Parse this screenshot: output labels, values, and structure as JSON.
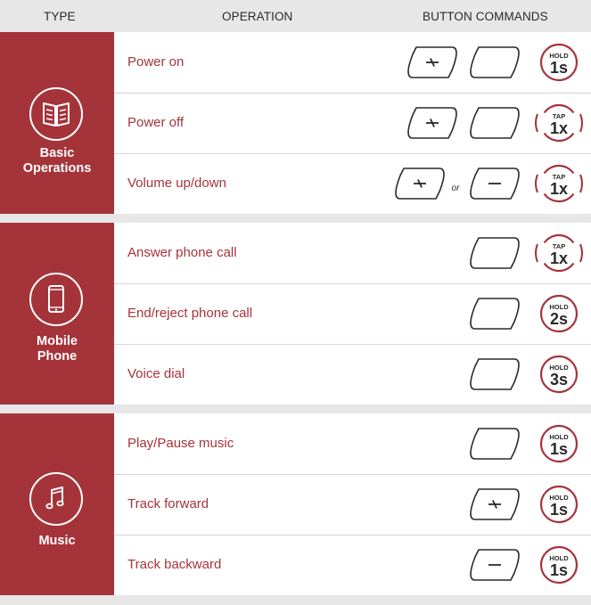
{
  "header": {
    "type": "TYPE",
    "operation": "OPERATION",
    "button_commands": "BUTTON COMMANDS"
  },
  "colors": {
    "accent": "#a5343a",
    "header_bg": "#e7e7e8",
    "text": "#2a2a2a"
  },
  "sections": [
    {
      "type_lines": [
        "Basic",
        "Operations"
      ],
      "icon": "book-icon",
      "rows": [
        {
          "operation": "Power on",
          "command": {
            "action": "HOLD",
            "value": "1s",
            "buttons": [
              "plus-button",
              "center-button"
            ]
          }
        },
        {
          "operation": "Power off",
          "command": {
            "action": "TAP",
            "value": "1x",
            "buttons": [
              "plus-button",
              "center-button"
            ]
          }
        },
        {
          "operation": "Volume up/down",
          "command": {
            "action": "TAP",
            "value": "1x",
            "buttons": [
              "plus-button",
              "minus-button"
            ],
            "separator": "or"
          }
        }
      ]
    },
    {
      "type_lines": [
        "Mobile",
        "Phone"
      ],
      "icon": "mobile-phone-icon",
      "rows": [
        {
          "operation": "Answer phone call",
          "command": {
            "action": "TAP",
            "value": "1x",
            "buttons": [
              "center-button"
            ]
          }
        },
        {
          "operation": "End/reject phone call",
          "command": {
            "action": "HOLD",
            "value": "2s",
            "buttons": [
              "center-button"
            ]
          }
        },
        {
          "operation": "Voice dial",
          "command": {
            "action": "HOLD",
            "value": "3s",
            "buttons": [
              "center-button"
            ]
          }
        }
      ]
    },
    {
      "type_lines": [
        "Music"
      ],
      "icon": "music-note-icon",
      "rows": [
        {
          "operation": "Play/Pause music",
          "command": {
            "action": "HOLD",
            "value": "1s",
            "buttons": [
              "center-button"
            ]
          }
        },
        {
          "operation": "Track forward",
          "command": {
            "action": "HOLD",
            "value": "1s",
            "buttons": [
              "plus-button"
            ]
          }
        },
        {
          "operation": "Track backward",
          "command": {
            "action": "HOLD",
            "value": "1s",
            "buttons": [
              "minus-button"
            ]
          }
        }
      ]
    }
  ]
}
